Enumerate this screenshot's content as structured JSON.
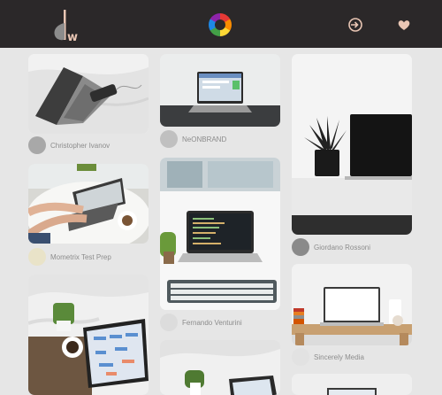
{
  "colors": {
    "topbar": "#2b2829",
    "accent": "#e9c6b4",
    "background": "#e6e6e6"
  },
  "header": {
    "logo_icon": "tw-logo-icon",
    "logo_text": "w",
    "theme_icon": "color-wheel-icon",
    "nav": [
      {
        "name": "login-icon"
      },
      {
        "name": "moon-icon"
      },
      {
        "name": "heart-icon"
      }
    ]
  },
  "photos": [
    {
      "author": "Christopher Ivanov",
      "scene": "laptop on white bedsheet"
    },
    {
      "author": "NeONBRAND",
      "scene": "laptop on dark desk"
    },
    {
      "author": "Giordano Rossoni",
      "scene": "black laptop with potted plant"
    },
    {
      "author": "Mometrix Test Prep",
      "scene": "hands typing on laptop"
    },
    {
      "author": "Fernando Venturini",
      "scene": "laptop and keyboard at window"
    },
    {
      "author": "Sincerely Media",
      "scene": "laptop on wooden desk"
    },
    {
      "author": "",
      "scene": "laptop with calendar on bed"
    },
    {
      "author": "",
      "scene": "laptop with plant on bed"
    },
    {
      "author": "",
      "scene": "laptop on desk"
    }
  ]
}
